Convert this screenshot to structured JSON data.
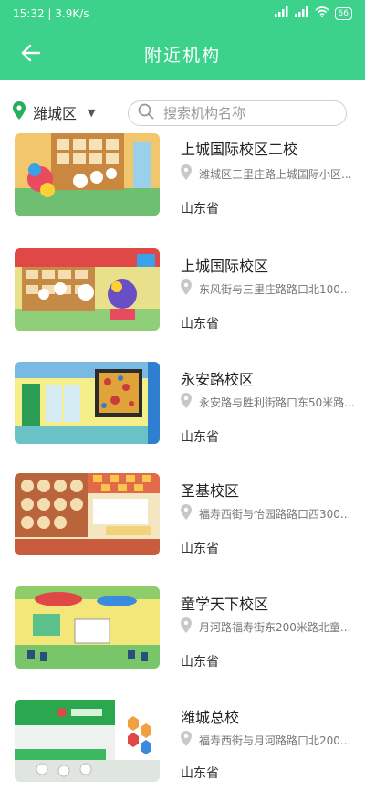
{
  "status": {
    "time_speed": "15:32 | 3.9K/s",
    "battery": "66"
  },
  "header": {
    "title": "附近机构"
  },
  "filter": {
    "region": "潍城区",
    "search_placeholder": "搜索机构名称"
  },
  "items": [
    {
      "name": "上城国际校区二校",
      "address": "潍城区三里庄路上城国际小区...",
      "province": "山东省"
    },
    {
      "name": "上城国际校区",
      "address": "东风街与三里庄路路口北100...",
      "province": "山东省"
    },
    {
      "name": "永安路校区",
      "address": "永安路与胜利街路口东50米路...",
      "province": "山东省"
    },
    {
      "name": "圣基校区",
      "address": "福寿西街与怡园路路口西300...",
      "province": "山东省"
    },
    {
      "name": "童学天下校区",
      "address": "月河路福寿街东200米路北童...",
      "province": "山东省"
    },
    {
      "name": "潍城总校",
      "address": "福寿西街与月河路路口北200...",
      "province": "山东省"
    }
  ]
}
